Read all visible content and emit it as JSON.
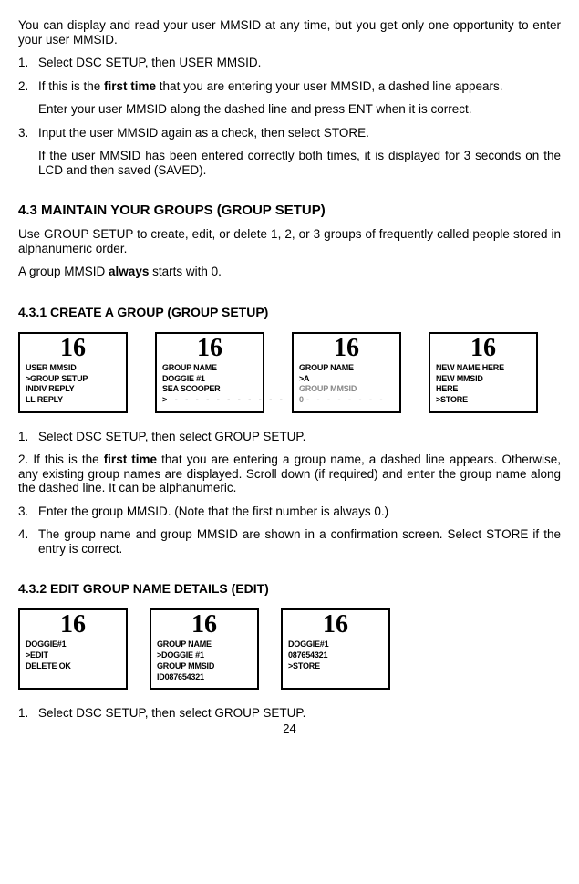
{
  "intro_p1": "You can display and read your user MMSID at any time, but you get only one opportunity to enter your user MMSID.",
  "steps_a": {
    "s1": "Select DSC SETUP, then USER MMSID.",
    "s2a": "If this is the ",
    "s2b": "first time",
    "s2c": " that you are entering your user MMSID, a dashed line appears.",
    "s2p": "Enter your user MMSID along the dashed line and press ENT when it is correct.",
    "s3a": "Input the user MMSID again as a check, then select STORE.",
    "s3p": "If the user MMSID has been entered correctly both times, it is displayed for 3 seconds on the LCD and then saved (SAVED)."
  },
  "h_43": "4.3 MAINTAIN YOUR GROUPS (GROUP SETUP)",
  "p_43a": "Use GROUP SETUP to create, edit, or delete 1, 2, or 3 groups of frequently called people stored in alphanumeric order.",
  "p_43b_pre": "A group MMSID ",
  "p_43b_bold": "always",
  "p_43b_post": " starts with 0.",
  "h_431": "4.3.1 CREATE A GROUP (GROUP SETUP)",
  "screens1": {
    "big": "16",
    "a": [
      "USER MMSID",
      ">GROUP SETUP",
      "INDIV REPLY",
      "LL REPLY"
    ],
    "b": [
      "GROUP NAME",
      "DOGGIE #1",
      "SEA SCOOPER",
      "> - - - - - - - - - - -"
    ],
    "c": [
      "GROUP NAME",
      ">A",
      "GROUP MMSID",
      "0- - - - - - - -"
    ],
    "d": [
      "NEW NAME HERE",
      "NEW MMSID",
      "HERE",
      ">STORE"
    ]
  },
  "steps_b": {
    "s1": "Select DSC SETUP, then select GROUP SETUP.",
    "s2a": "If this is the ",
    "s2b": "first time",
    "s2c": " that you are entering a group name, a dashed line appears. Otherwise, any existing group names are displayed. Scroll down (if required) and enter the group name along the dashed line. It can be alphanumeric.",
    "s3": "Enter the group MMSID. (Note that the first number is always 0.)",
    "s4": "The group name and group MMSID are shown in a confirmation screen. Select STORE if the entry is correct."
  },
  "h_432": "4.3.2 EDIT GROUP NAME DETAILS (EDIT)",
  "screens2": {
    "big": "16",
    "a": [
      "DOGGIE#1",
      ">EDIT",
      "DELETE  OK"
    ],
    "b": [
      "GROUP NAME",
      ">DOGGIE #1",
      "GROUP MMSID",
      "ID087654321"
    ],
    "c": [
      "DOGGIE#1",
      "087654321",
      ">STORE"
    ]
  },
  "steps_c": {
    "s1": "Select DSC SETUP, then select GROUP SETUP."
  },
  "pagenum": "24"
}
